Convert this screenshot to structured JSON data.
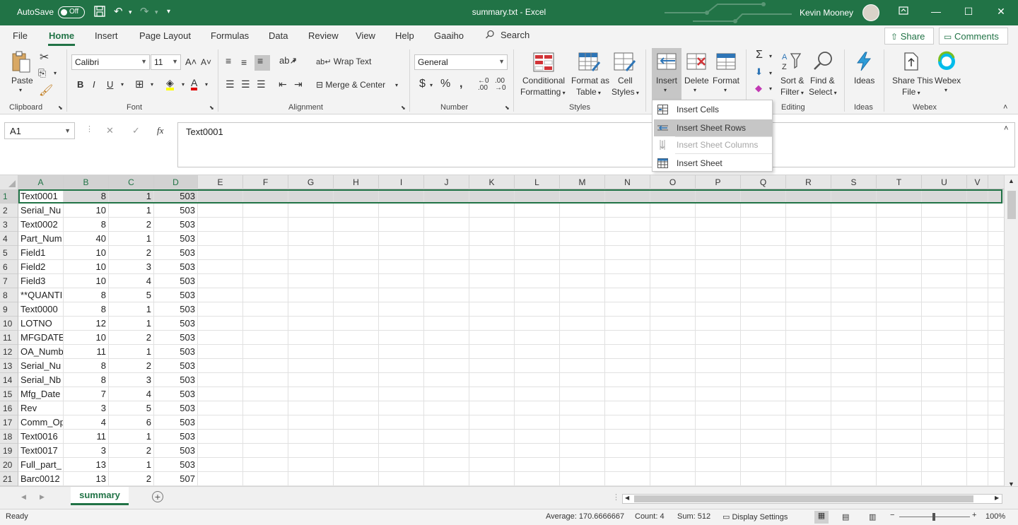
{
  "titlebar": {
    "autosave_label": "AutoSave",
    "autosave_state": "Off",
    "document_title": "summary.txt  -  Excel",
    "user_name": "Kevin Mooney"
  },
  "tabs": {
    "items": [
      "File",
      "Home",
      "Insert",
      "Page Layout",
      "Formulas",
      "Data",
      "Review",
      "View",
      "Help",
      "Gaaiho"
    ],
    "active": "Home",
    "search_label": "Search",
    "share_label": "Share",
    "comments_label": "Comments"
  },
  "ribbon": {
    "clipboard": {
      "label": "Clipboard",
      "paste": "Paste"
    },
    "font": {
      "label": "Font",
      "name": "Calibri",
      "size": "11"
    },
    "alignment": {
      "label": "Alignment",
      "wrap_text": "Wrap Text",
      "merge_center": "Merge & Center"
    },
    "number": {
      "label": "Number",
      "format": "General"
    },
    "styles": {
      "label": "Styles",
      "conditional_1": "Conditional",
      "conditional_2": "Formatting",
      "format_table_1": "Format as",
      "format_table_2": "Table",
      "cell_styles_1": "Cell",
      "cell_styles_2": "Styles"
    },
    "cells": {
      "insert": "Insert",
      "delete": "Delete",
      "format": "Format"
    },
    "editing": {
      "label": "Editing",
      "sort_1": "Sort &",
      "sort_2": "Filter",
      "find_1": "Find &",
      "find_2": "Select"
    },
    "ideas": {
      "label": "Ideas",
      "button": "Ideas"
    },
    "webex": {
      "label": "Webex",
      "share_1": "Share This",
      "share_2": "File",
      "webex": "Webex"
    }
  },
  "insert_menu": {
    "items": [
      {
        "label": "Insert Cells",
        "state": "normal"
      },
      {
        "label": "Insert Sheet Rows",
        "state": "hover"
      },
      {
        "label": "Insert Sheet Columns",
        "state": "disabled"
      },
      {
        "label": "Insert Sheet",
        "state": "normal"
      }
    ]
  },
  "formula_bar": {
    "name_box": "A1",
    "cancel_icon": "✕",
    "enter_icon": "✓",
    "fx_label": "fx",
    "value": "Text0001"
  },
  "grid": {
    "columns": [
      "A",
      "B",
      "C",
      "D",
      "E",
      "F",
      "G",
      "H",
      "I",
      "J",
      "K",
      "L",
      "M",
      "N",
      "O",
      "P",
      "Q",
      "R",
      "S",
      "T",
      "U",
      "V"
    ],
    "rows": [
      [
        "Text0001",
        "8",
        "1",
        "503"
      ],
      [
        "Serial_Nu",
        "10",
        "1",
        "503"
      ],
      [
        "Text0002",
        "8",
        "2",
        "503"
      ],
      [
        "Part_Num",
        "40",
        "1",
        "503"
      ],
      [
        "Field1",
        "10",
        "2",
        "503"
      ],
      [
        "Field2",
        "10",
        "3",
        "503"
      ],
      [
        "Field3",
        "10",
        "4",
        "503"
      ],
      [
        "**QUANTI",
        "8",
        "5",
        "503"
      ],
      [
        "Text0000",
        "8",
        "1",
        "503"
      ],
      [
        "LOTNO",
        "12",
        "1",
        "503"
      ],
      [
        "MFGDATE",
        "10",
        "2",
        "503"
      ],
      [
        "OA_Numb",
        "11",
        "1",
        "503"
      ],
      [
        "Serial_Nu",
        "8",
        "2",
        "503"
      ],
      [
        "Serial_Nb",
        "8",
        "3",
        "503"
      ],
      [
        "Mfg_Date",
        "7",
        "4",
        "503"
      ],
      [
        "Rev",
        "3",
        "5",
        "503"
      ],
      [
        "Comm_Op",
        "4",
        "6",
        "503"
      ],
      [
        "Text0016",
        "11",
        "1",
        "503"
      ],
      [
        "Text0017",
        "3",
        "2",
        "503"
      ],
      [
        "Full_part_",
        "13",
        "1",
        "503"
      ],
      [
        "Barc0012",
        "13",
        "2",
        "507"
      ]
    ]
  },
  "sheets": {
    "active": "summary"
  },
  "status": {
    "ready": "Ready",
    "average": "Average: 170.6666667",
    "count": "Count: 4",
    "sum": "Sum: 512",
    "display_settings": "Display Settings",
    "zoom": "100%"
  },
  "colors": {
    "accent": "#217346"
  }
}
